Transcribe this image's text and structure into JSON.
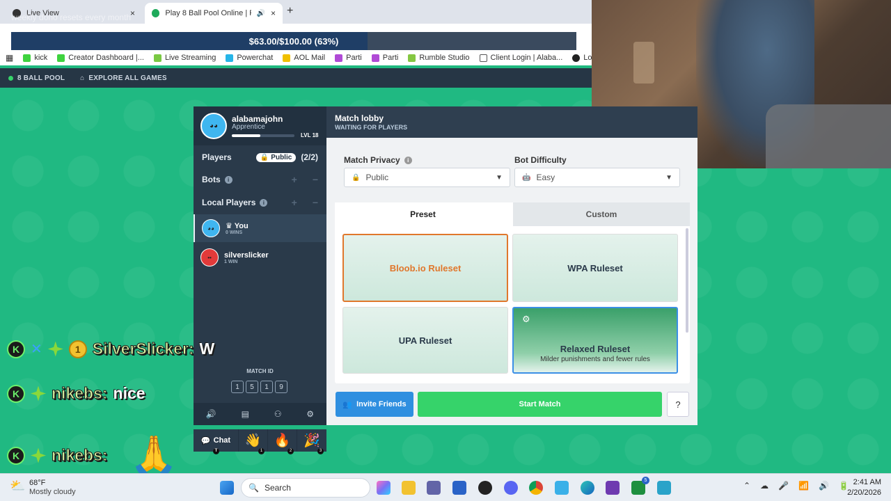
{
  "browser": {
    "tabs": [
      {
        "label": "Live View",
        "close": "×"
      },
      {
        "label": "Play 8 Ball Pool Online | Fre",
        "close": "×"
      }
    ],
    "new_tab": "+",
    "overlay_text": "weekly dono resets every month",
    "donation_goal": {
      "text": "$63.00/$100.00 (63%)",
      "progress": 0.63
    },
    "bookmarks": [
      "kick",
      "Creator Dashboard |...",
      "Live Streaming",
      "Powerchat",
      "AOL Mail",
      "Parti",
      "Parti",
      "Rumble Studio",
      "Client Login | Alaba...",
      "Login"
    ]
  },
  "site_nav": {
    "game": "8 BALL POOL",
    "explore": "EXPLORE ALL GAMES"
  },
  "profile": {
    "username": "alabamajohn",
    "rank": "Apprentice",
    "level": "LVL 18",
    "xp_progress": 0.45
  },
  "left": {
    "players_label": "Players",
    "privacy_badge": "Public",
    "player_count": "(2/2)",
    "bots_label": "Bots",
    "local_players_label": "Local Players",
    "plus": "+",
    "minus": "−",
    "players": [
      {
        "name": "You",
        "wins": "0 WINS",
        "crown": "♛"
      },
      {
        "name": "silverslicker",
        "wins": "1 WIN"
      }
    ],
    "match_id_label": "MATCH ID",
    "match_id_digits": [
      "1",
      "5",
      "1",
      "9"
    ]
  },
  "chat": {
    "label": "Chat",
    "emotes": [
      "👋",
      "🔥",
      "🎉"
    ],
    "emote_keys": [
      "1",
      "2",
      "3"
    ],
    "chat_key": "T"
  },
  "lobby": {
    "title": "Match lobby",
    "status": "WAITING FOR PLAYERS",
    "privacy_label": "Match Privacy",
    "privacy_value": "Public",
    "bot_label": "Bot Difficulty",
    "bot_value": "Easy",
    "tabs": [
      "Preset",
      "Custom"
    ],
    "rulesets": [
      {
        "name": "Bloob.io Ruleset",
        "selected": true
      },
      {
        "name": "WPA Ruleset"
      },
      {
        "name": "UPA Ruleset"
      },
      {
        "name": "Relaxed Ruleset",
        "subtitle": "Milder punishments and fewer rules",
        "hover": true
      }
    ],
    "invite_label": "Invite Friends",
    "start_label": "Start Match",
    "help_label": "?"
  },
  "stream_chat": [
    {
      "name": "SilverSlicker:",
      "message": "W",
      "badge": "1"
    },
    {
      "name": "nikebs:",
      "message": "nice"
    },
    {
      "name": "nikebs:",
      "message": ""
    }
  ],
  "taskbar": {
    "weather_temp": "68°F",
    "weather_desc": "Mostly cloudy",
    "search_placeholder": "Search",
    "time": "2:41 AM",
    "date": "2/20/2026",
    "notif_count": "5"
  },
  "colors": {
    "accent_green": "#36d36a",
    "invite_blue": "#2f8fe0",
    "selected_orange": "#e0772c",
    "hover_blue": "#3b8fe6",
    "game_bg": "#20b982"
  }
}
